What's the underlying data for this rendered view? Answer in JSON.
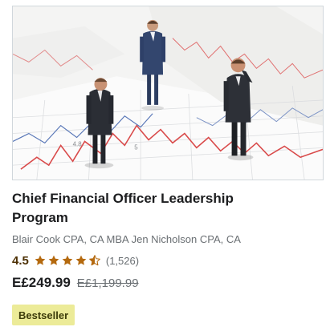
{
  "course": {
    "title": "Chief Financial Officer Leadership Program",
    "instructors": "Blair Cook CPA, CA MBA Jen Nicholson CPA, CA",
    "rating": "4.5",
    "rating_count": "(1,526)",
    "stars": [
      {
        "fill": "full",
        "icon": "star-icon"
      },
      {
        "fill": "full",
        "icon": "star-icon"
      },
      {
        "fill": "full",
        "icon": "star-icon"
      },
      {
        "fill": "full",
        "icon": "star-icon"
      },
      {
        "fill": "half",
        "icon": "star-half-icon"
      }
    ],
    "price_current": "E£249.99",
    "price_original": "E£1,199.99",
    "badge": "Bestseller",
    "thumbnail_icon": "businessmen-on-chart-image"
  },
  "colors": {
    "title": "#1c1d1f",
    "muted": "#6a6f73",
    "rating_text": "#4d3105",
    "star": "#b4690e",
    "badge_bg": "#eceb98",
    "badge_text": "#3d3c0a"
  }
}
